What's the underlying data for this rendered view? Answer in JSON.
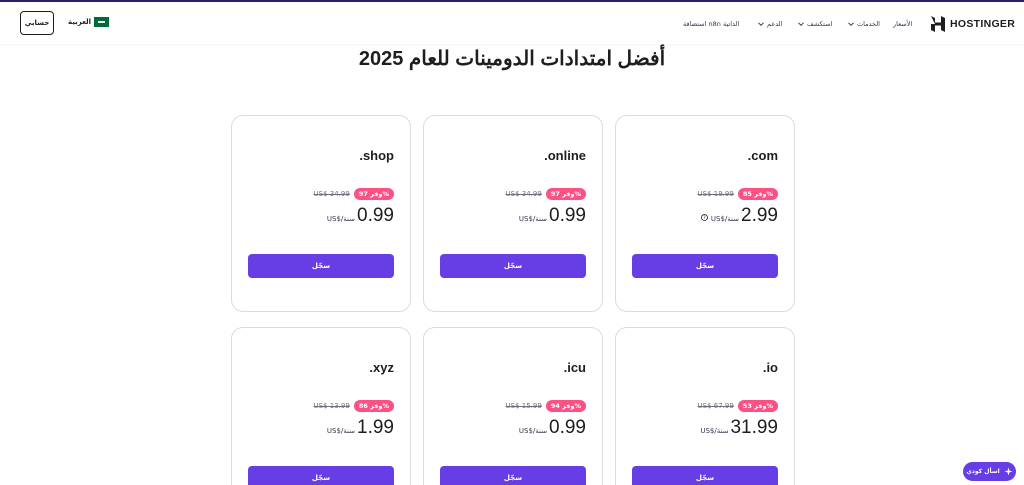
{
  "header": {
    "account_label": "حسابي",
    "language_label": "العربية",
    "brand": "HOSTINGER",
    "nav": {
      "pricing": "الأسعار",
      "services": "الخدمات",
      "explore": "استكشف",
      "support": "الدعم",
      "n8n": "استضافة n8n الذاتية"
    }
  },
  "page_title": "أفضل امتدادات الدومينات للعام 2025",
  "cards": [
    {
      "tld": ".com",
      "discount": "وفر 85%",
      "old_price": "US$ 19.99",
      "price": "2.99",
      "per": "US$/سنة",
      "cta": "سجّل"
    },
    {
      "tld": ".online",
      "discount": "وفر 97%",
      "old_price": "US$ 34.99",
      "price": "0.99",
      "per": "US$/سنة",
      "cta": "سجّل"
    },
    {
      "tld": ".shop",
      "discount": "وفر 97%",
      "old_price": "US$ 34.99",
      "price": "0.99",
      "per": "US$/سنة",
      "cta": "سجّل"
    },
    {
      "tld": ".io",
      "discount": "وفر 53%",
      "old_price": "US$ 67.99",
      "price": "31.99",
      "per": "US$/سنة",
      "cta": "سجّل"
    },
    {
      "tld": ".icu",
      "discount": "وفر 94%",
      "old_price": "US$ 15.99",
      "price": "0.99",
      "per": "US$/سنة",
      "cta": "سجّل"
    },
    {
      "tld": ".xyz",
      "discount": "وفر 86%",
      "old_price": "US$ 13.99",
      "price": "1.99",
      "per": "US$/سنة",
      "cta": "سجّل"
    }
  ],
  "chat": {
    "label": "اسأل كودي"
  },
  "colors": {
    "accent": "#673de6",
    "badge": "#fc5185",
    "flag": "#006c35",
    "text": "#1d1e20"
  }
}
